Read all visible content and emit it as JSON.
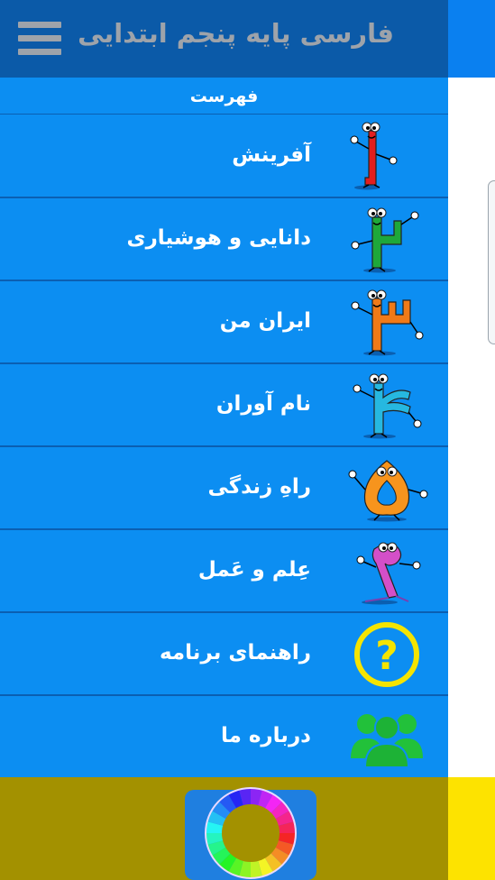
{
  "header": {
    "title": "فارسی پایه پنجم ابتدایی",
    "menu_icon": "hamburger-menu-icon"
  },
  "drawer": {
    "heading": "فهرست",
    "items": [
      {
        "label": "آفرینش",
        "icon": "digit-1-character-icon"
      },
      {
        "label": "دانایی و هوشیاری",
        "icon": "digit-2-character-icon"
      },
      {
        "label": "ایران من",
        "icon": "digit-3-character-icon"
      },
      {
        "label": "نام آوران",
        "icon": "digit-4-character-icon"
      },
      {
        "label": "راهِ زندگی",
        "icon": "digit-5-character-icon"
      },
      {
        "label": "عِلم و عَمل",
        "icon": "digit-6-character-icon"
      },
      {
        "label": "راهنمای برنامه",
        "icon": "help-question-icon"
      },
      {
        "label": "درباره ما",
        "icon": "people-group-icon"
      }
    ]
  },
  "footer": {
    "button_icon": "color-wheel-camera-icon"
  },
  "colors": {
    "drawer_bg": "#0c8ef2",
    "header_bg": "#0b5aa8",
    "footer_bg": "#a39100",
    "accent_yellow": "#fde300"
  }
}
